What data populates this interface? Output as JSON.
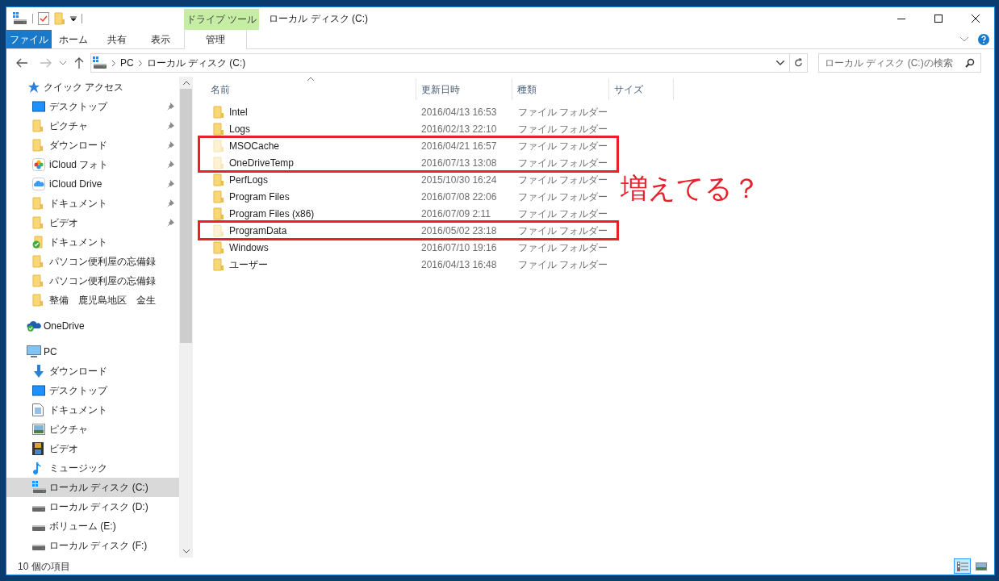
{
  "title_bar": {
    "context_tab": "ドライブ ツール",
    "title": "ローカル ディスク (C:)"
  },
  "ribbon_tabs": [
    {
      "label": "ファイル",
      "kind": "file"
    },
    {
      "label": "ホーム",
      "kind": "tab"
    },
    {
      "label": "共有",
      "kind": "tab"
    },
    {
      "label": "表示",
      "kind": "tab"
    },
    {
      "label": "管理",
      "kind": "context"
    }
  ],
  "address_bar": {
    "path": [
      "PC",
      "ローカル ディスク (C:)"
    ]
  },
  "search": {
    "placeholder": "ローカル ディスク (C:)の検索"
  },
  "sidebar": {
    "items": [
      {
        "label": "クイック アクセス",
        "kind": "star",
        "selected": false,
        "children": [
          {
            "label": "デスクトップ",
            "kind": "desktop",
            "pinned": true,
            "selected": false
          },
          {
            "label": "ピクチャ",
            "kind": "folder",
            "pinned": true,
            "selected": false
          },
          {
            "label": "ダウンロード",
            "kind": "folder",
            "pinned": true,
            "selected": false
          },
          {
            "label": "iCloud フォト",
            "kind": "photos",
            "pinned": true,
            "selected": false
          },
          {
            "label": "iCloud Drive",
            "kind": "icloud",
            "pinned": true,
            "selected": false
          },
          {
            "label": "ドキュメント",
            "kind": "folder",
            "pinned": true,
            "selected": false
          },
          {
            "label": "ビデオ",
            "kind": "folder",
            "pinned": true,
            "selected": false
          },
          {
            "label": "ドキュメント",
            "kind": "folder-synced",
            "pinned": false,
            "selected": false
          },
          {
            "label": "パソコン便利屋の忘備録",
            "kind": "folder",
            "pinned": false,
            "selected": false
          },
          {
            "label": "パソコン便利屋の忘備録",
            "kind": "folder",
            "pinned": false,
            "selected": false
          },
          {
            "label": "整備　鹿児島地区　金生",
            "kind": "folder",
            "pinned": false,
            "selected": false
          }
        ]
      },
      {
        "label": "OneDrive",
        "kind": "onedrive",
        "selected": false
      },
      {
        "label": "PC",
        "kind": "pc",
        "selected": false,
        "children": [
          {
            "label": "ダウンロード",
            "kind": "download",
            "selected": false
          },
          {
            "label": "デスクトップ",
            "kind": "desktop",
            "selected": false
          },
          {
            "label": "ドキュメント",
            "kind": "document",
            "selected": false
          },
          {
            "label": "ピクチャ",
            "kind": "picture",
            "selected": false
          },
          {
            "label": "ビデオ",
            "kind": "video",
            "selected": false
          },
          {
            "label": "ミュージック",
            "kind": "music",
            "selected": false
          },
          {
            "label": "ローカル ディスク (C:)",
            "kind": "drive-windows",
            "selected": true
          },
          {
            "label": "ローカル ディスク (D:)",
            "kind": "drive",
            "selected": false
          },
          {
            "label": "ボリューム (E:)",
            "kind": "drive",
            "selected": false
          },
          {
            "label": "ローカル ディスク (F:)",
            "kind": "drive",
            "selected": false
          }
        ]
      }
    ]
  },
  "columns": [
    "名前",
    "更新日時",
    "種類",
    "サイズ"
  ],
  "rows": [
    {
      "name": "Intel",
      "modified": "2016/04/13 16:53",
      "type": "ファイル フォルダー",
      "hidden": false,
      "highlighted": false
    },
    {
      "name": "Logs",
      "modified": "2016/02/13 22:10",
      "type": "ファイル フォルダー",
      "hidden": false,
      "highlighted": false
    },
    {
      "name": "MSOCache",
      "modified": "2016/04/21 16:57",
      "type": "ファイル フォルダー",
      "hidden": true,
      "highlighted": true
    },
    {
      "name": "OneDriveTemp",
      "modified": "2016/07/13 13:08",
      "type": "ファイル フォルダー",
      "hidden": true,
      "highlighted": true
    },
    {
      "name": "PerfLogs",
      "modified": "2015/10/30 16:24",
      "type": "ファイル フォルダー",
      "hidden": false,
      "highlighted": false
    },
    {
      "name": "Program Files",
      "modified": "2016/07/08 22:06",
      "type": "ファイル フォルダー",
      "hidden": false,
      "highlighted": false
    },
    {
      "name": "Program Files (x86)",
      "modified": "2016/07/09 2:11",
      "type": "ファイル フォルダー",
      "hidden": false,
      "highlighted": false
    },
    {
      "name": "ProgramData",
      "modified": "2016/05/02 23:18",
      "type": "ファイル フォルダー",
      "hidden": true,
      "highlighted": true
    },
    {
      "name": "Windows",
      "modified": "2016/07/10 19:16",
      "type": "ファイル フォルダー",
      "hidden": false,
      "highlighted": false
    },
    {
      "name": "ユーザー",
      "modified": "2016/04/13 16:48",
      "type": "ファイル フォルダー",
      "hidden": false,
      "highlighted": false
    }
  ],
  "annotation": "増えてる？",
  "status_bar": {
    "item_count": "10 個の項目"
  },
  "view_buttons": [
    {
      "kind": "details",
      "selected": true
    },
    {
      "kind": "large-icons",
      "selected": false
    }
  ]
}
